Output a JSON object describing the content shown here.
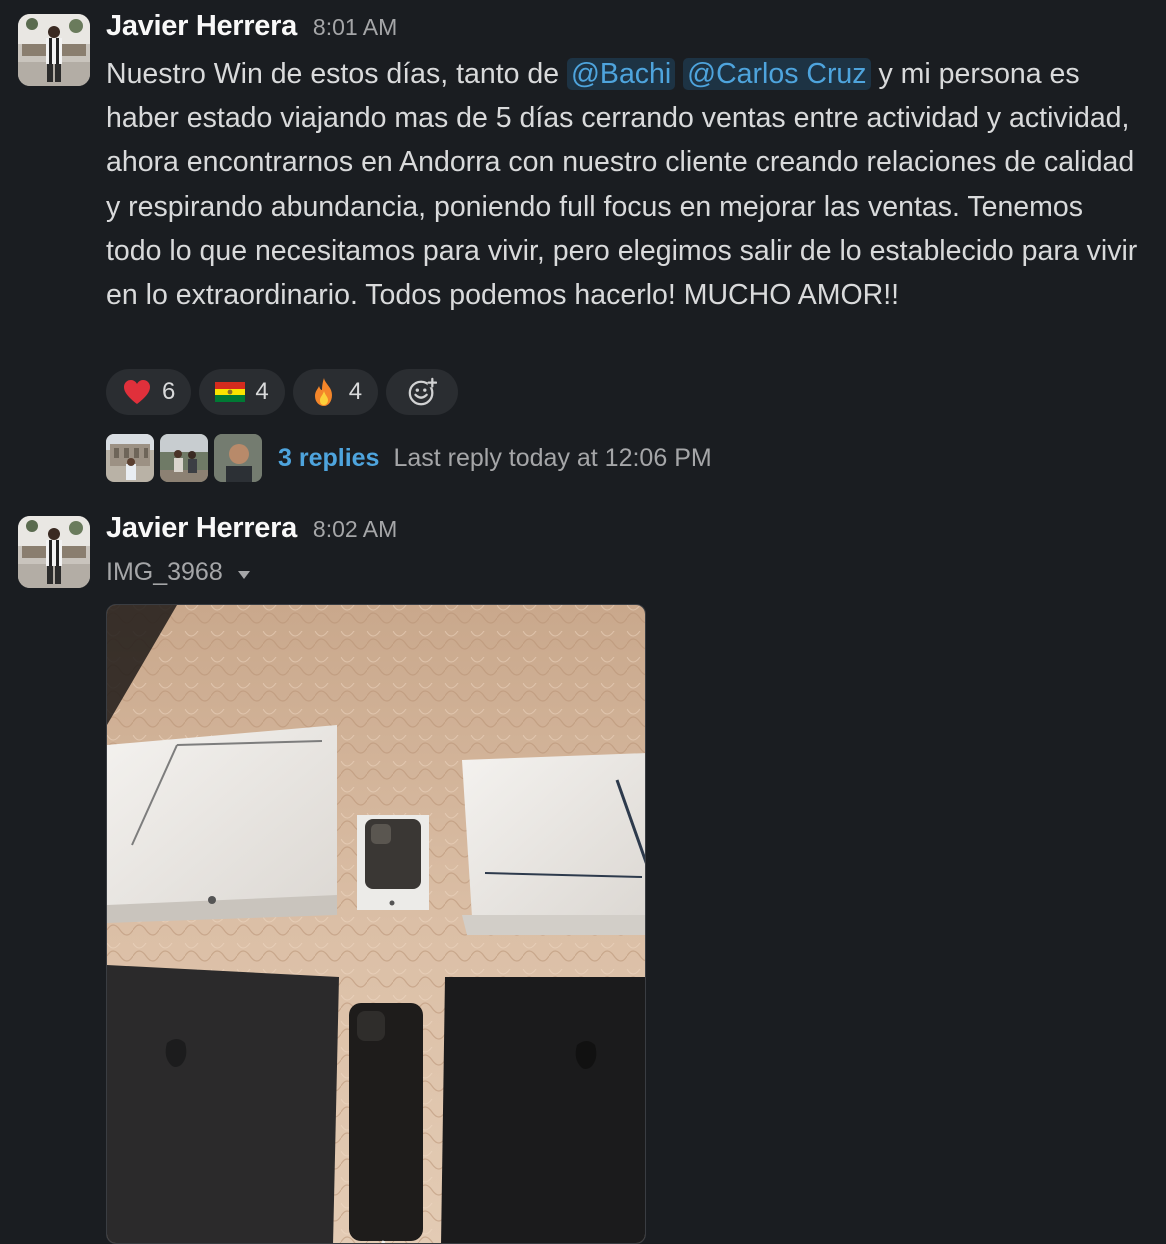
{
  "messages": [
    {
      "author": "Javier Herrera",
      "time": "8:01 AM",
      "text_parts": {
        "p1": "Nuestro Win de estos días, tanto de ",
        "mention1": "@Bachi",
        "p2": " ",
        "mention2": "@Carlos Cruz",
        "p3": " y mi persona es haber estado viajando mas de 5 días cerrando ventas entre actividad y actividad, ahora encontrarnos en Andorra con nuestro cliente creando relaciones de calidad y respirando abundancia, poniendo full focus en mejorar las ventas. Tenemos todo lo que necesitamos para vivir, pero elegimos salir de lo establecido para vivir en lo extraordinario. Todos podemos hacerlo! MUCHO AMOR!!"
      },
      "reactions": [
        {
          "emoji": "heart-emoji",
          "count": "6"
        },
        {
          "emoji": "bolivia-flag-emoji",
          "count": "4"
        },
        {
          "emoji": "fire-emoji",
          "count": "4"
        }
      ],
      "add_reaction_icon": "add-reaction-icon",
      "thread": {
        "replies_label": "3 replies",
        "last_reply": "Last reply today at 12:06 PM"
      }
    },
    {
      "author": "Javier Herrera",
      "time": "8:02 AM",
      "file_name": "IMG_3968",
      "file_menu_icon": "caret-down-icon"
    }
  ],
  "colors": {
    "background": "#1a1d21",
    "link": "#4ea4dd",
    "mention_bg": "#1d3344",
    "reaction_bg": "#2a2d31"
  }
}
